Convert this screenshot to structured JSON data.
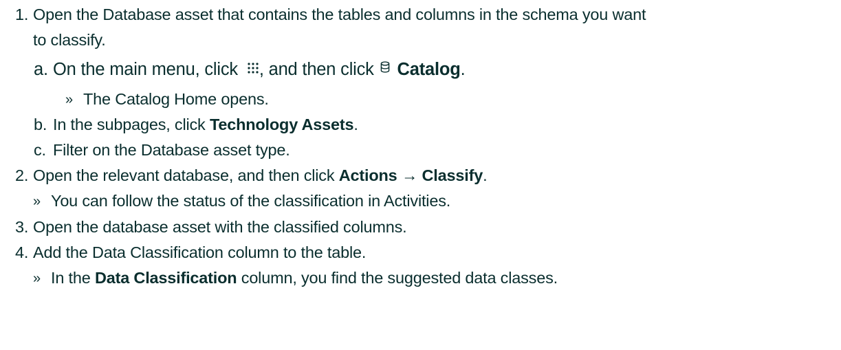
{
  "steps": [
    {
      "number": "1.",
      "text_line1": "Open the Database asset that contains the tables and columns in the schema you want",
      "text_line2": "to classify.",
      "substeps": [
        {
          "letter": "a.",
          "part1": "On the main menu, click",
          "icon1": "apps-grid-icon",
          "part2": ", and then click",
          "icon2": "database-icon",
          "bold": "Catalog",
          "end": ".",
          "result": "The Catalog Home opens."
        },
        {
          "letter": "b.",
          "part1": "In the subpages, click",
          "bold": "Technology Assets",
          "end": "."
        },
        {
          "letter": "c.",
          "part1": "Filter on the Database asset type."
        }
      ]
    },
    {
      "number": "2.",
      "part1": "Open the relevant database, and then click",
      "bold1": "Actions",
      "arrow": "→",
      "bold2": "Classify",
      "end": ".",
      "result": "You can follow the status of the classification in Activities."
    },
    {
      "number": "3.",
      "text": "Open the database asset with the classified columns."
    },
    {
      "number": "4.",
      "text": "Add the Data Classification column to the table.",
      "result_part1": "In the",
      "result_bold": "Data Classification",
      "result_part2": "column, you find the suggested data classes."
    }
  ],
  "result_marker": "»",
  "colors": {
    "text": "#0a2e2e",
    "background": "#ffffff"
  }
}
